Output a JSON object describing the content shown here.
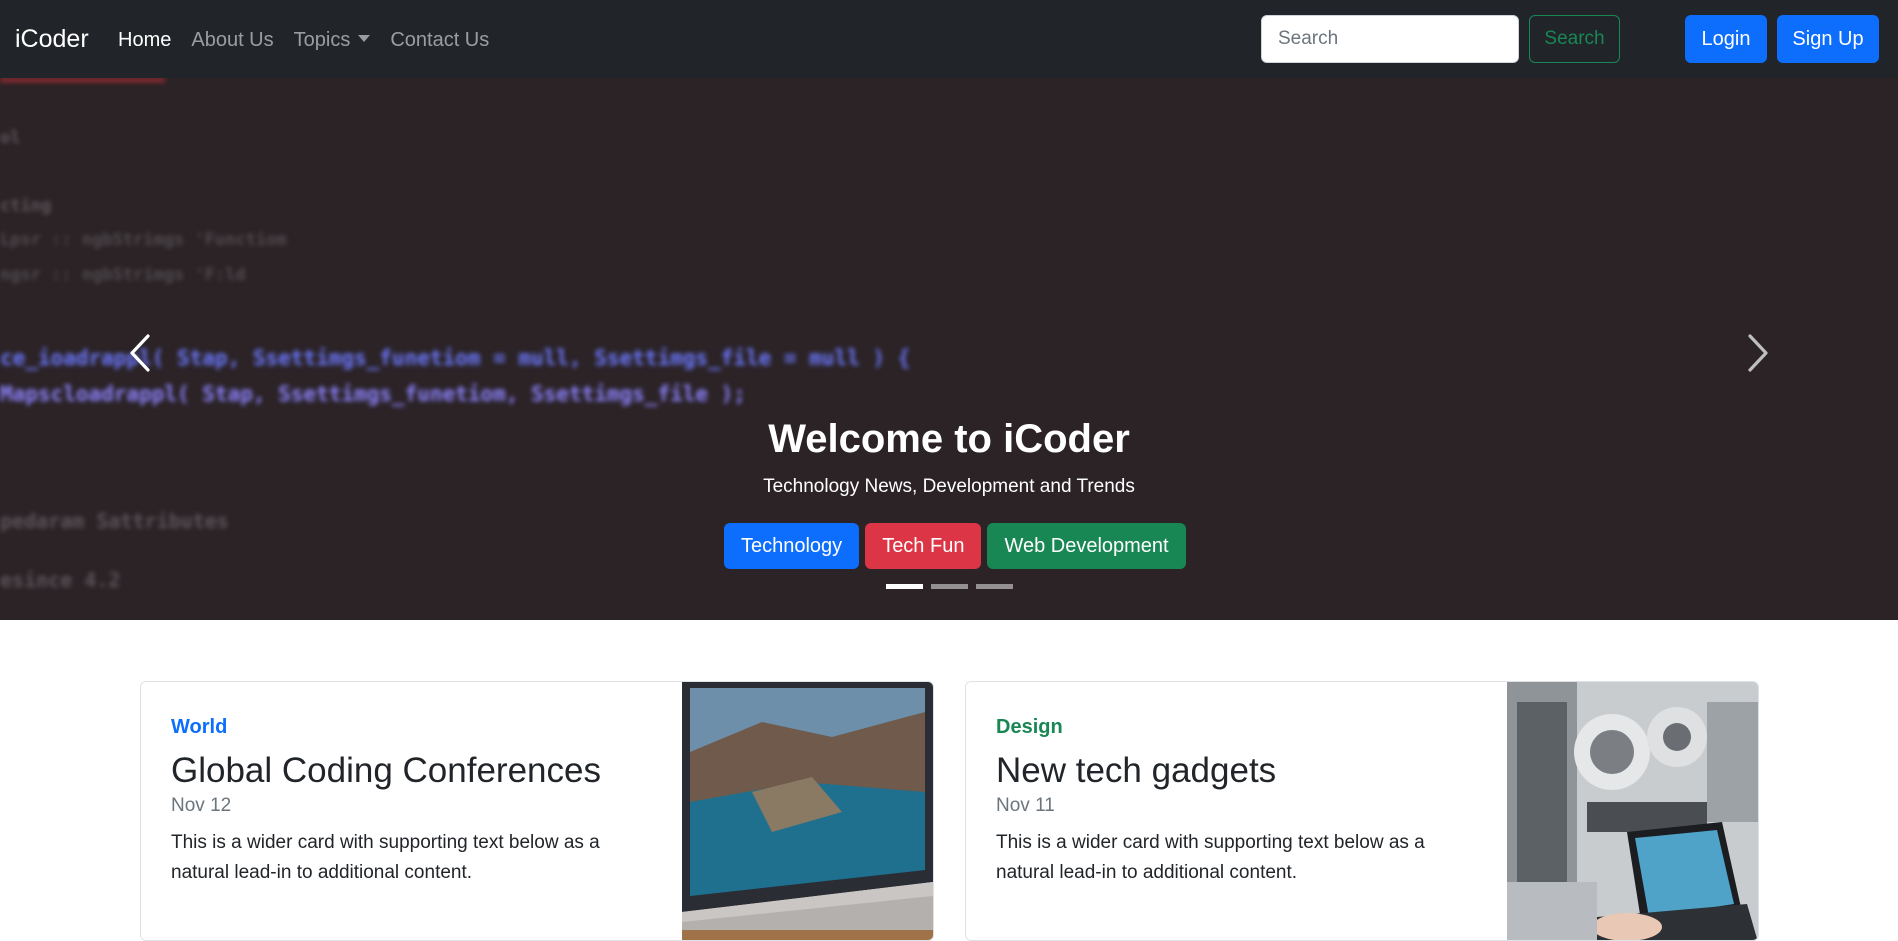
{
  "navbar": {
    "brand": "iCoder",
    "links": [
      {
        "label": "Home",
        "active": true
      },
      {
        "label": "About Us",
        "active": false
      },
      {
        "label": "Topics",
        "active": false,
        "dropdown": true
      },
      {
        "label": "Contact Us",
        "active": false
      }
    ],
    "search_placeholder": "Search",
    "search_button": "Search",
    "login_button": "Login",
    "signup_button": "Sign Up"
  },
  "hero": {
    "title": "Welcome to iCoder",
    "subtitle": "Technology News, Development and Trends",
    "buttons": [
      "Technology",
      "Tech Fun",
      "Web Development"
    ],
    "slide_count": 3,
    "active_slide": 0,
    "code_lines": [
      "ol",
      "cting",
      "Lpsr :: ngbStrimgs 'Functiom",
      "ngsr :: ngbStrimgs 'F:ld",
      "ce_ioadrappl( Stap, Ssettimgs_funetiom = mull, Ssettimgs_file = mull ) {",
      "Mapscloadrappl( Stap, Ssettimgs_funetiom, Ssettimgs_file );",
      "pedaram Sattributes",
      "esince 4.2"
    ]
  },
  "cards": [
    {
      "category": "World",
      "title": "Global Coding Conferences",
      "date": "Nov 12",
      "text": "This is a wider card with supporting text below as a natural lead-in to additional content."
    },
    {
      "category": "Design",
      "title": "New tech gadgets",
      "date": "Nov 11",
      "text": "This is a wider card with supporting text below as a natural lead-in to additional content."
    }
  ],
  "colors": {
    "navbar_bg": "#212529",
    "primary": "#0d6efd",
    "danger": "#dc3545",
    "success": "#198754"
  }
}
